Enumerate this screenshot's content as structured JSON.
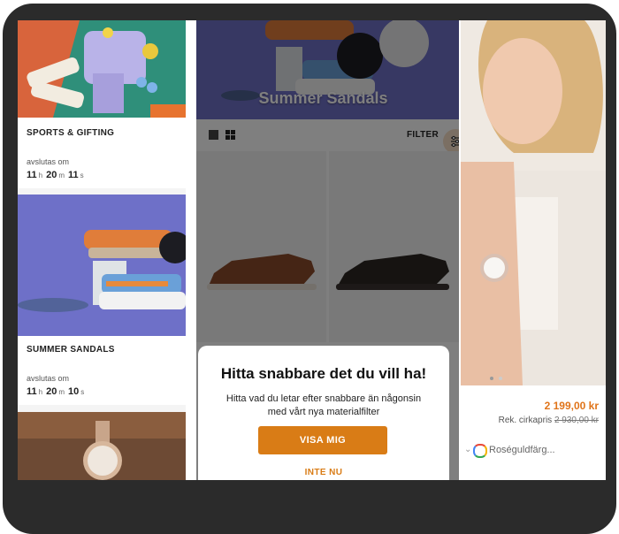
{
  "left_cards": [
    {
      "title": "SPORTS & GIFTING",
      "ends_label": "avslutas om",
      "timer": {
        "h": "11",
        "h_unit": "h",
        "m": "20",
        "m_unit": "m",
        "s": "11",
        "s_unit": "s"
      }
    },
    {
      "title": "SUMMER SANDALS",
      "ends_label": "avslutas om",
      "timer": {
        "h": "11",
        "h_unit": "h",
        "m": "20",
        "m_unit": "m",
        "s": "10",
        "s_unit": "s"
      }
    }
  ],
  "middle": {
    "banner_title": "Summer Sandals",
    "filter_label": "FILTER",
    "modal": {
      "title": "Hitta snabbare det du vill ha!",
      "body": "Hitta vad du letar efter snabbare än någonsin med vårt nya materialfilter",
      "primary_button": "VISA MIG",
      "secondary_link": "INTE NU"
    }
  },
  "right": {
    "price": "2 199,00 kr",
    "ref_label": "Rek. cirkapris",
    "ref_price": "2 930,00 kr",
    "color_option": "Roséguldfärg..."
  },
  "colors": {
    "accent": "#d97c16",
    "price": "#e0741a",
    "frame": "#2b2b2b"
  },
  "icons": [
    "list-view-icon",
    "grid-view-icon",
    "filter-sliders-icon",
    "color-wheel-icon",
    "chevron-down-icon"
  ]
}
